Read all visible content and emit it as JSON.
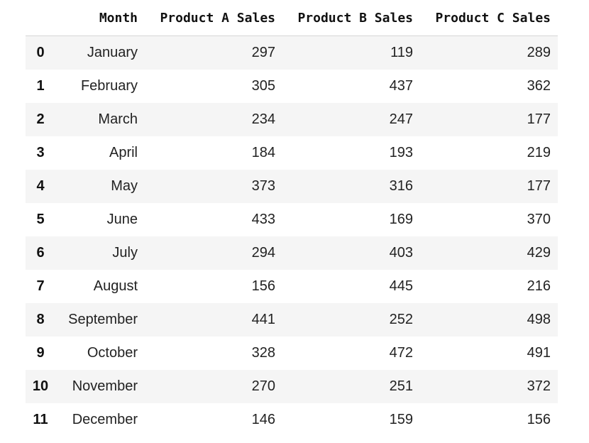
{
  "table": {
    "columns": [
      "",
      "Month",
      "Product A Sales",
      "Product B Sales",
      "Product C Sales"
    ],
    "rows": [
      {
        "index": "0",
        "month": "January",
        "a": "297",
        "b": "119",
        "c": "289"
      },
      {
        "index": "1",
        "month": "February",
        "a": "305",
        "b": "437",
        "c": "362"
      },
      {
        "index": "2",
        "month": "March",
        "a": "234",
        "b": "247",
        "c": "177"
      },
      {
        "index": "3",
        "month": "April",
        "a": "184",
        "b": "193",
        "c": "219"
      },
      {
        "index": "4",
        "month": "May",
        "a": "373",
        "b": "316",
        "c": "177"
      },
      {
        "index": "5",
        "month": "June",
        "a": "433",
        "b": "169",
        "c": "370"
      },
      {
        "index": "6",
        "month": "July",
        "a": "294",
        "b": "403",
        "c": "429"
      },
      {
        "index": "7",
        "month": "August",
        "a": "156",
        "b": "445",
        "c": "216"
      },
      {
        "index": "8",
        "month": "September",
        "a": "441",
        "b": "252",
        "c": "498"
      },
      {
        "index": "9",
        "month": "October",
        "a": "328",
        "b": "472",
        "c": "491"
      },
      {
        "index": "10",
        "month": "November",
        "a": "270",
        "b": "251",
        "c": "372"
      },
      {
        "index": "11",
        "month": "December",
        "a": "146",
        "b": "159",
        "c": "156"
      }
    ]
  },
  "colors": {
    "stripe": "#f5f5f5",
    "header_border": "#d6d6d6",
    "text": "#222222"
  }
}
